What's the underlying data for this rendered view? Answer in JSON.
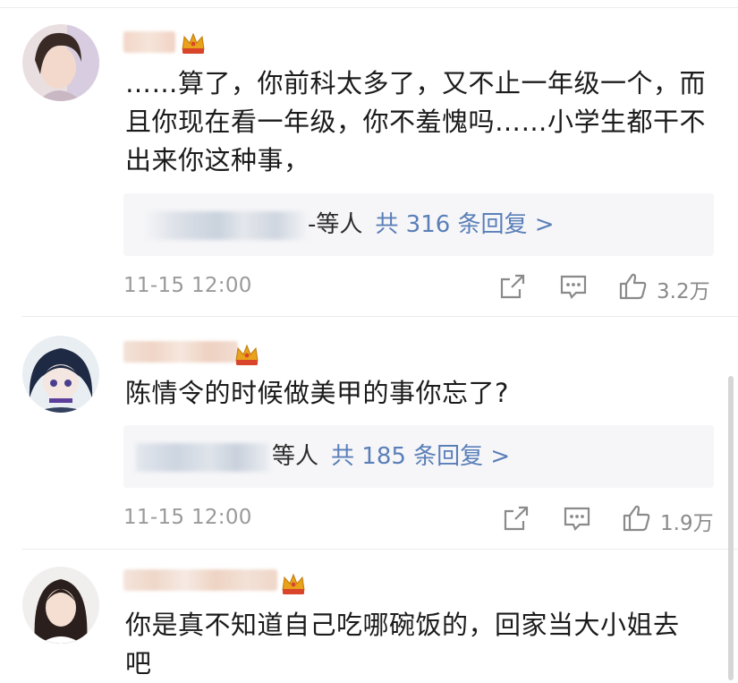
{
  "comments": [
    {
      "text": "……算了，你前科太多了，又不止一年级一个，而\n且你现在看一年级，你不羞愧吗……小学生都干不\n出来你这种事，",
      "reply_suffix": "-等人",
      "reply_count": "共 316 条回复 >",
      "time": "11-15 12:00",
      "likes": "3.2万"
    },
    {
      "text": "陈情令的时候做美甲的事你忘了?",
      "reply_suffix": "等人",
      "reply_count": "共 185 条回复 >",
      "time": "11-15 12:00",
      "likes": "1.9万"
    },
    {
      "text": "你是真不知道自己吃哪碗饭的，回家当大小姐去\n吧"
    }
  ],
  "colors": {
    "link": "#5a7fb8",
    "crown_gold": "#e8a21b",
    "crown_red": "#d9452b"
  },
  "icons": [
    "crown-badge-icon",
    "share-icon",
    "comment-icon",
    "like-icon"
  ]
}
